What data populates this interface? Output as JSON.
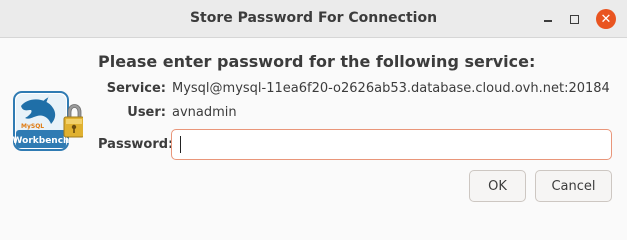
{
  "window": {
    "title": "Store Password For Connection",
    "controls": [
      "minimize-icon",
      "maximize-icon",
      "close-icon"
    ],
    "close_color": "#e95420"
  },
  "logo": {
    "text_top": "MySQL",
    "text_bottom": "Workbench"
  },
  "dialog": {
    "heading": "Please enter password for the following service:",
    "service_label": "Service:",
    "service_value": "Mysql@mysql-11ea6f20-o2626ab53.database.cloud.ovh.net:20184",
    "user_label": "User:",
    "user_value": "avnadmin",
    "password_label": "Password:",
    "password_value": "",
    "password_focus_color": "#e9967a"
  },
  "buttons": {
    "ok": "OK",
    "cancel": "Cancel"
  }
}
